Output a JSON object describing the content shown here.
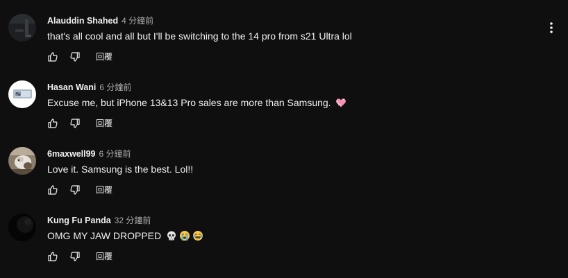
{
  "comments": [
    {
      "author": "Alauddin Shahed",
      "time": "4 分鐘前",
      "text": "that's all cool and all but I'll be switching to the 14 pro from s21 Ultra lol",
      "reply_label": "回覆",
      "emojis": []
    },
    {
      "author": "Hasan Wani",
      "time": "6 分鐘前",
      "text": "Excuse me, but iPhone 13&13 Pro sales are more than Samsung.",
      "reply_label": "回覆",
      "emojis": [
        "sparkling-heart"
      ]
    },
    {
      "author": "6maxwell99",
      "time": "6 分鐘前",
      "text": "Love it. Samsung is the best. Lol!!",
      "reply_label": "回覆",
      "emojis": []
    },
    {
      "author": "Kung Fu Panda",
      "time": "32 分鐘前",
      "text": "OMG MY JAW DROPPED",
      "reply_label": "回覆",
      "emojis": [
        "skull",
        "loudly-crying-face",
        "face-with-tears-of-joy"
      ]
    }
  ],
  "colors": {
    "background": "#0f0f0f",
    "primary_text": "#f1f1f1",
    "secondary_text": "#aaaaaa"
  }
}
